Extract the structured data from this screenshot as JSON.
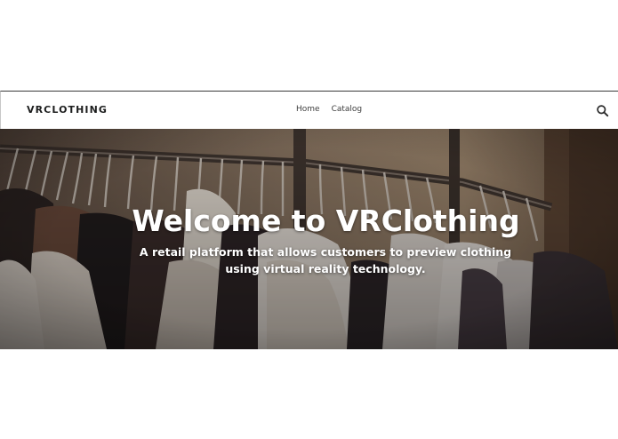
{
  "header": {
    "logo": "VRCLOTHING",
    "nav": [
      {
        "label": "Home"
      },
      {
        "label": "Catalog"
      }
    ],
    "search_icon": "search-icon"
  },
  "hero": {
    "title": "Welcome to VRClothing",
    "subtitle": "A retail platform that allows customers to preview clothing using virtual reality technology.",
    "background": "clothing-rack-photo"
  },
  "colors": {
    "header_bg": "#ffffff",
    "logo_text": "#1c1d1d",
    "nav_text": "#3d3d3d",
    "hero_text": "#ffffff"
  }
}
